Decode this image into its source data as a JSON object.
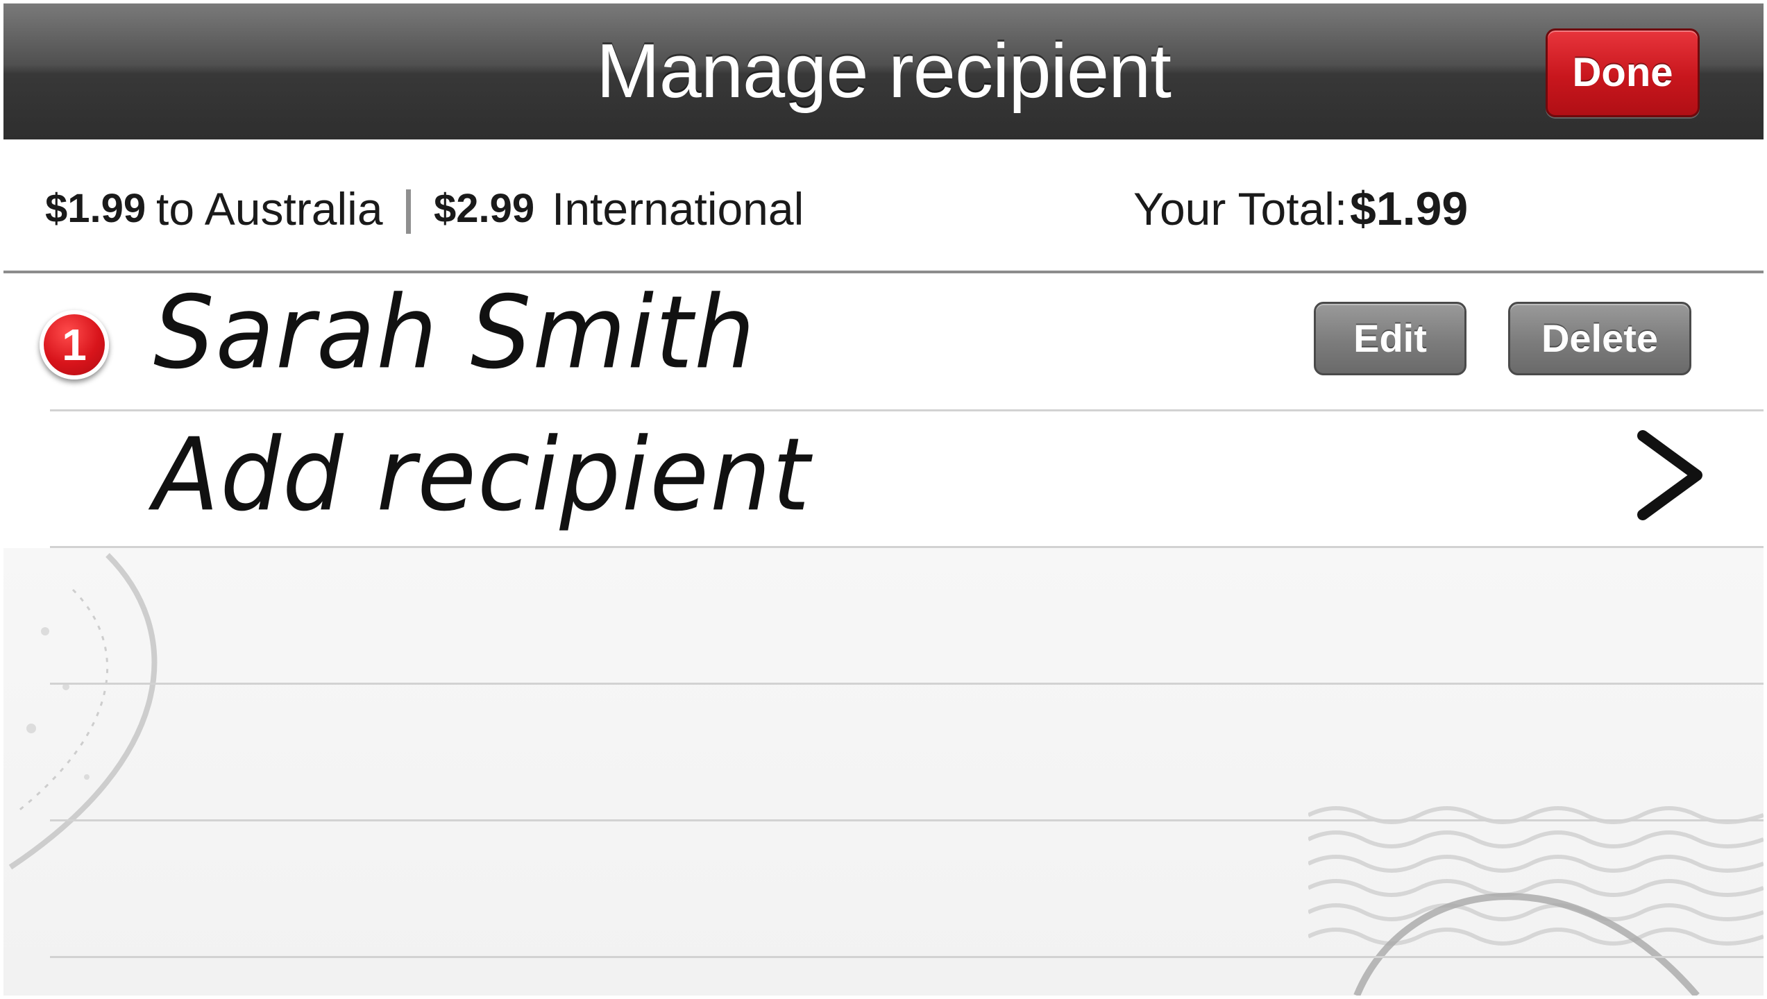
{
  "header": {
    "title": "Manage recipient",
    "done_label": "Done"
  },
  "pricing": {
    "domestic_price": "$1.99",
    "domestic_label": "to Australia",
    "international_price": "$2.99",
    "international_label": "International",
    "total_label": "Your Total:",
    "total_value": "$1.99"
  },
  "recipients": [
    {
      "number": "1",
      "name": "Sarah Smith"
    }
  ],
  "actions": {
    "edit_label": "Edit",
    "delete_label": "Delete",
    "add_label": "Add recipient"
  },
  "colors": {
    "header_dark": "#2e2e2e",
    "done_red": "#c8161d",
    "badge_red": "#d8141b",
    "button_gray": "#7c7c7c"
  },
  "icons": [
    "chevron-right-icon",
    "postmark-stamp-icon"
  ]
}
